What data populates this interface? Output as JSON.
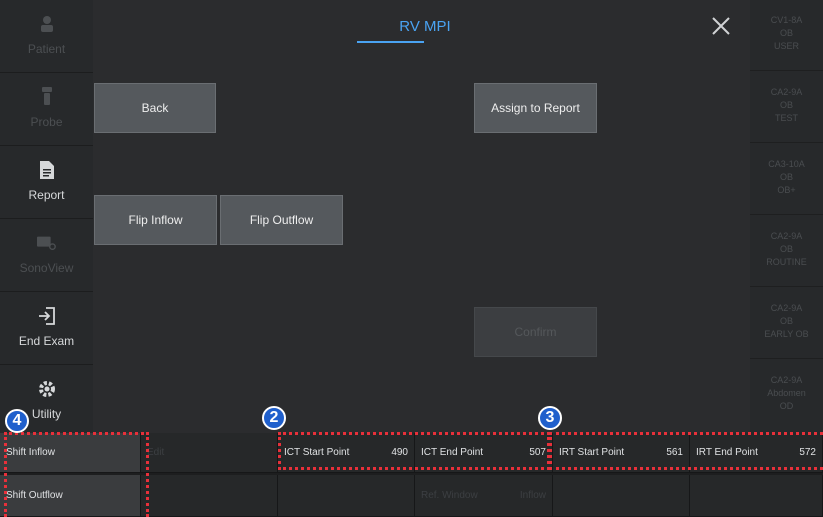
{
  "sidebar": {
    "items": [
      {
        "label": "Patient",
        "icon": "person-icon",
        "enabled": false
      },
      {
        "label": "Probe",
        "icon": "probe-icon",
        "enabled": false
      },
      {
        "label": "Report",
        "icon": "document-icon",
        "enabled": true
      },
      {
        "label": "SonoView",
        "icon": "sonoview-icon",
        "enabled": false
      },
      {
        "label": "End Exam",
        "icon": "exit-icon",
        "enabled": true
      },
      {
        "label": "Utility",
        "icon": "gear-icon",
        "enabled": true
      }
    ]
  },
  "main": {
    "title": "RV MPI",
    "buttons": {
      "back": "Back",
      "assign": "Assign to Report",
      "flip_inflow": "Flip Inflow",
      "flip_outflow": "Flip Outflow",
      "confirm": "Confirm"
    }
  },
  "presets": [
    {
      "line1": "CV1-8A",
      "line2": "OB",
      "line3": "USER"
    },
    {
      "line1": "CA2-9A",
      "line2": "OB",
      "line3": "TEST"
    },
    {
      "line1": "CA3-10A",
      "line2": "OB",
      "line3": "OB+"
    },
    {
      "line1": "CA2-9A",
      "line2": "OB",
      "line3": "ROUTINE"
    },
    {
      "line1": "CA2-9A",
      "line2": "OB",
      "line3": "EARLY OB"
    },
    {
      "line1": "CA2-9A",
      "line2": "Abdomen",
      "line3": "OD"
    }
  ],
  "bottom": {
    "shift_inflow": "Shift Inflow",
    "shift_outflow": "Shift Outflow",
    "dim_edit": "Edit",
    "ict_start_label": "ICT Start Point",
    "ict_start_value": "490",
    "ict_end_label": "ICT End Point",
    "ict_end_value": "507",
    "irt_start_label": "IRT Start Point",
    "irt_start_value": "561",
    "irt_end_label": "IRT End Point",
    "irt_end_value": "572",
    "ref_window_label": "Ref. Window",
    "ref_window_value": "Inflow"
  },
  "annotations": {
    "b2": "2",
    "b3": "3",
    "b4": "4"
  },
  "colors": {
    "accent": "#4aa3f2",
    "highlight": "#e8303a",
    "badge": "#1f5fcc"
  }
}
